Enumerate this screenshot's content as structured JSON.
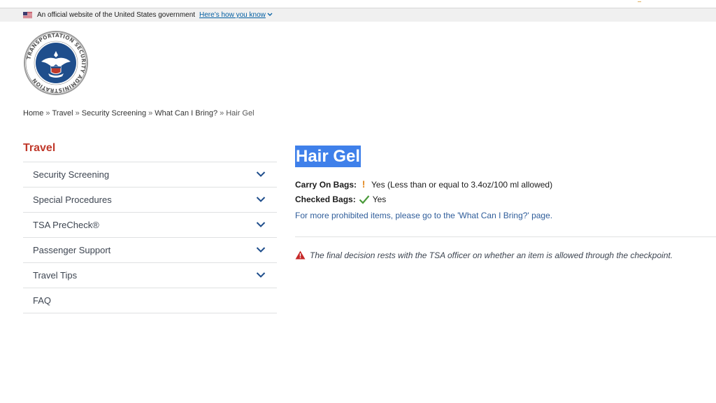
{
  "gov_banner": {
    "text": "An official website of the United States government",
    "link": "Here’s how you know"
  },
  "logo": {
    "alt": "Transportation Security Administration seal",
    "ring_text": "TRANSPORTATION SECURITY ADMINISTRATION"
  },
  "breadcrumb": {
    "items": [
      "Home",
      "Travel",
      "Security Screening",
      "What Can I Bring?"
    ],
    "current": "Hair Gel",
    "separator": "»"
  },
  "sidebar": {
    "title": "Travel",
    "items": [
      {
        "label": "Security Screening"
      },
      {
        "label": "Special Procedures"
      },
      {
        "label": "TSA PreCheck®"
      },
      {
        "label": "Passenger Support"
      },
      {
        "label": "Travel Tips"
      },
      {
        "label": "FAQ"
      }
    ]
  },
  "item": {
    "title": "Hair Gel",
    "carry_on_label": "Carry On Bags:",
    "carry_on_value": "Yes (Less than or equal to 3.4oz/100 ml allowed)",
    "checked_label": "Checked Bags:",
    "checked_value": "Yes",
    "more_link": "For more prohibited items, please go to the 'What Can I Bring?' page.",
    "warning": "The final decision rests with the TSA officer on whether an item is allowed through the checkpoint."
  },
  "colors": {
    "accent_red": "#c0392b",
    "link_blue": "#2f5d9a",
    "selection_blue": "#3f80ea",
    "nav_chevron": "#1f4e8c",
    "check_green": "#4a9a3a",
    "excl_orange": "#e38a23",
    "warn_red": "#c62828"
  }
}
